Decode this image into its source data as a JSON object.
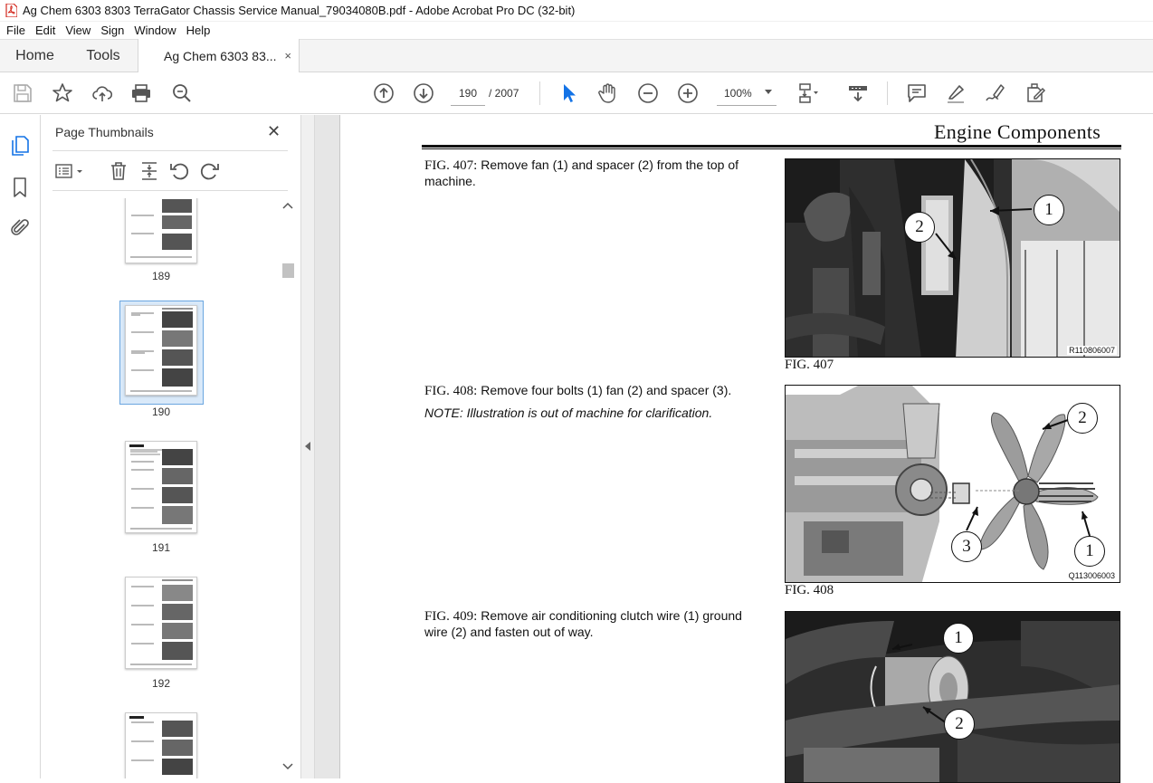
{
  "window": {
    "title": "Ag Chem 6303 8303 TerraGator Chassis Service Manual_79034080B.pdf - Adobe Acrobat Pro DC (32-bit)"
  },
  "menu": [
    "File",
    "Edit",
    "View",
    "Sign",
    "Window",
    "Help"
  ],
  "tabs": {
    "home": "Home",
    "tools": "Tools",
    "document": "Ag Chem 6303 83...",
    "close": "×"
  },
  "toolbar": {
    "current_page": "190",
    "page_total": "/  2007",
    "zoom": "100%"
  },
  "panel": {
    "title": "Page Thumbnails",
    "close": "✕",
    "thumbnails": [
      {
        "label": "189"
      },
      {
        "label": "190",
        "selected": true
      },
      {
        "label": "191"
      },
      {
        "label": "192"
      },
      {
        "label": ""
      }
    ]
  },
  "page": {
    "section_title": "Engine Components",
    "figures": [
      {
        "fig_no": "FIG. 407:",
        "text": "Remove fan (1) and spacer (2) from the top of machine.",
        "note": "",
        "code": "R110806007",
        "caption": "FIG. 407",
        "callouts": [
          "1",
          "2"
        ]
      },
      {
        "fig_no": "FIG. 408:",
        "text": "Remove four bolts (1) fan (2) and spacer (3).",
        "note": "NOTE:  Illustration is out of machine for clarification.",
        "code": "Q113006003",
        "caption": "FIG. 408",
        "callouts": [
          "2",
          "3",
          "1"
        ]
      },
      {
        "fig_no": "FIG. 409:",
        "text": "Remove air conditioning clutch wire (1) ground wire (2) and fasten out of way.",
        "note": "",
        "code": "",
        "caption": "",
        "callouts": [
          "1",
          "2"
        ]
      }
    ]
  },
  "colors": {
    "accent": "#1473e6",
    "selection": "#d9e9f9"
  }
}
